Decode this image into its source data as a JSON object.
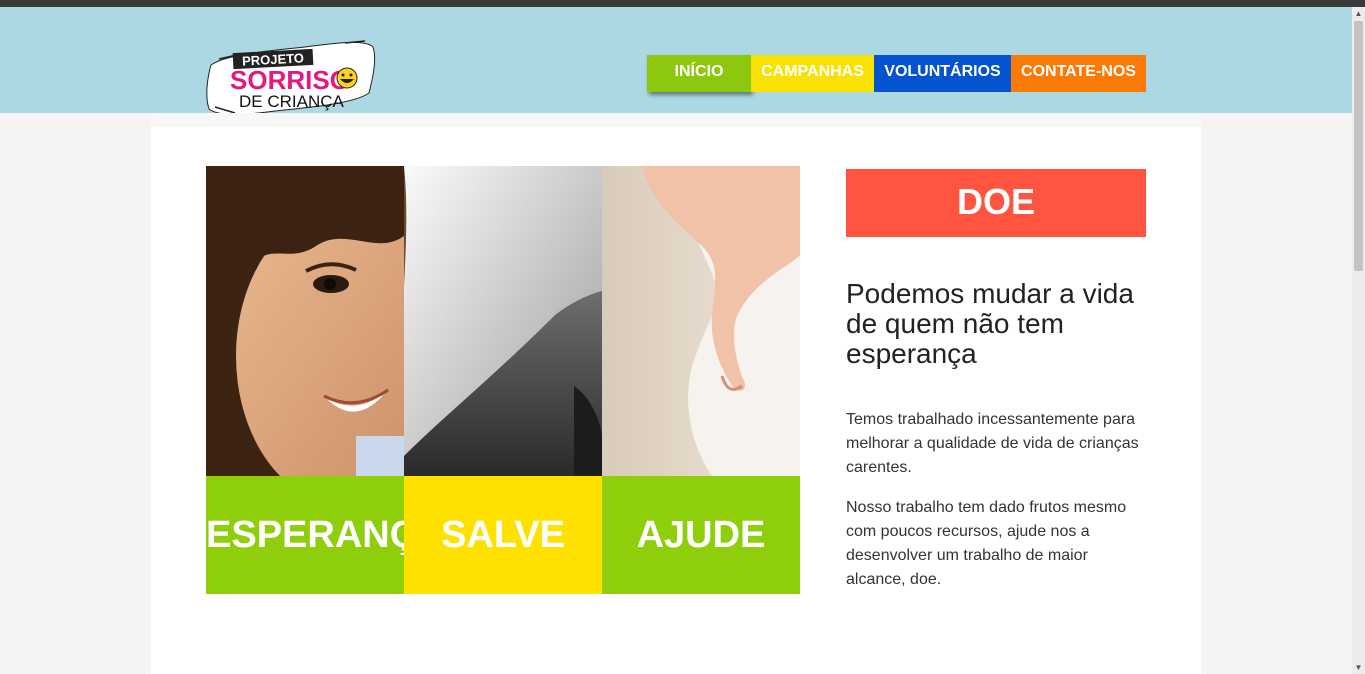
{
  "logo": {
    "line1": "PROJETO",
    "line2": "SORRISO",
    "line3": "DE CRIANÇA"
  },
  "nav": {
    "inicio": "INÍCIO",
    "campanhas": "CAMPANHAS",
    "voluntarios": "VOLUNTÁRIOS",
    "contate": "CONTATE-NOS"
  },
  "panels": [
    {
      "label": "ESPERANÇA"
    },
    {
      "label": "SALVE"
    },
    {
      "label": "AJUDE"
    }
  ],
  "donate": {
    "label": "DOE"
  },
  "content": {
    "headline": "Podemos mudar a vida de quem não tem esperança",
    "paragraph1": "Temos trabalhado incessantemente para melhorar a qualidade de vida de crianças carentes.",
    "paragraph2": "Nosso trabalho tem dado frutos mesmo com poucos recursos, ajude nos a desenvolver um trabalho de maior alcance, doe."
  },
  "colors": {
    "header_bg": "#acd8e4",
    "nav_inicio": "#8dc80e",
    "nav_campanhas": "#f9e103",
    "nav_voluntarios": "#0553cf",
    "nav_contate": "#fb7a06",
    "panel_green": "#8fce0a",
    "panel_yellow": "#ffe100",
    "donate": "#ff5440"
  },
  "icons": {
    "scroll_up": "scroll-up-arrow-icon",
    "scroll_down": "scroll-down-arrow-icon",
    "logo_smiley": "smiley-face-icon"
  }
}
